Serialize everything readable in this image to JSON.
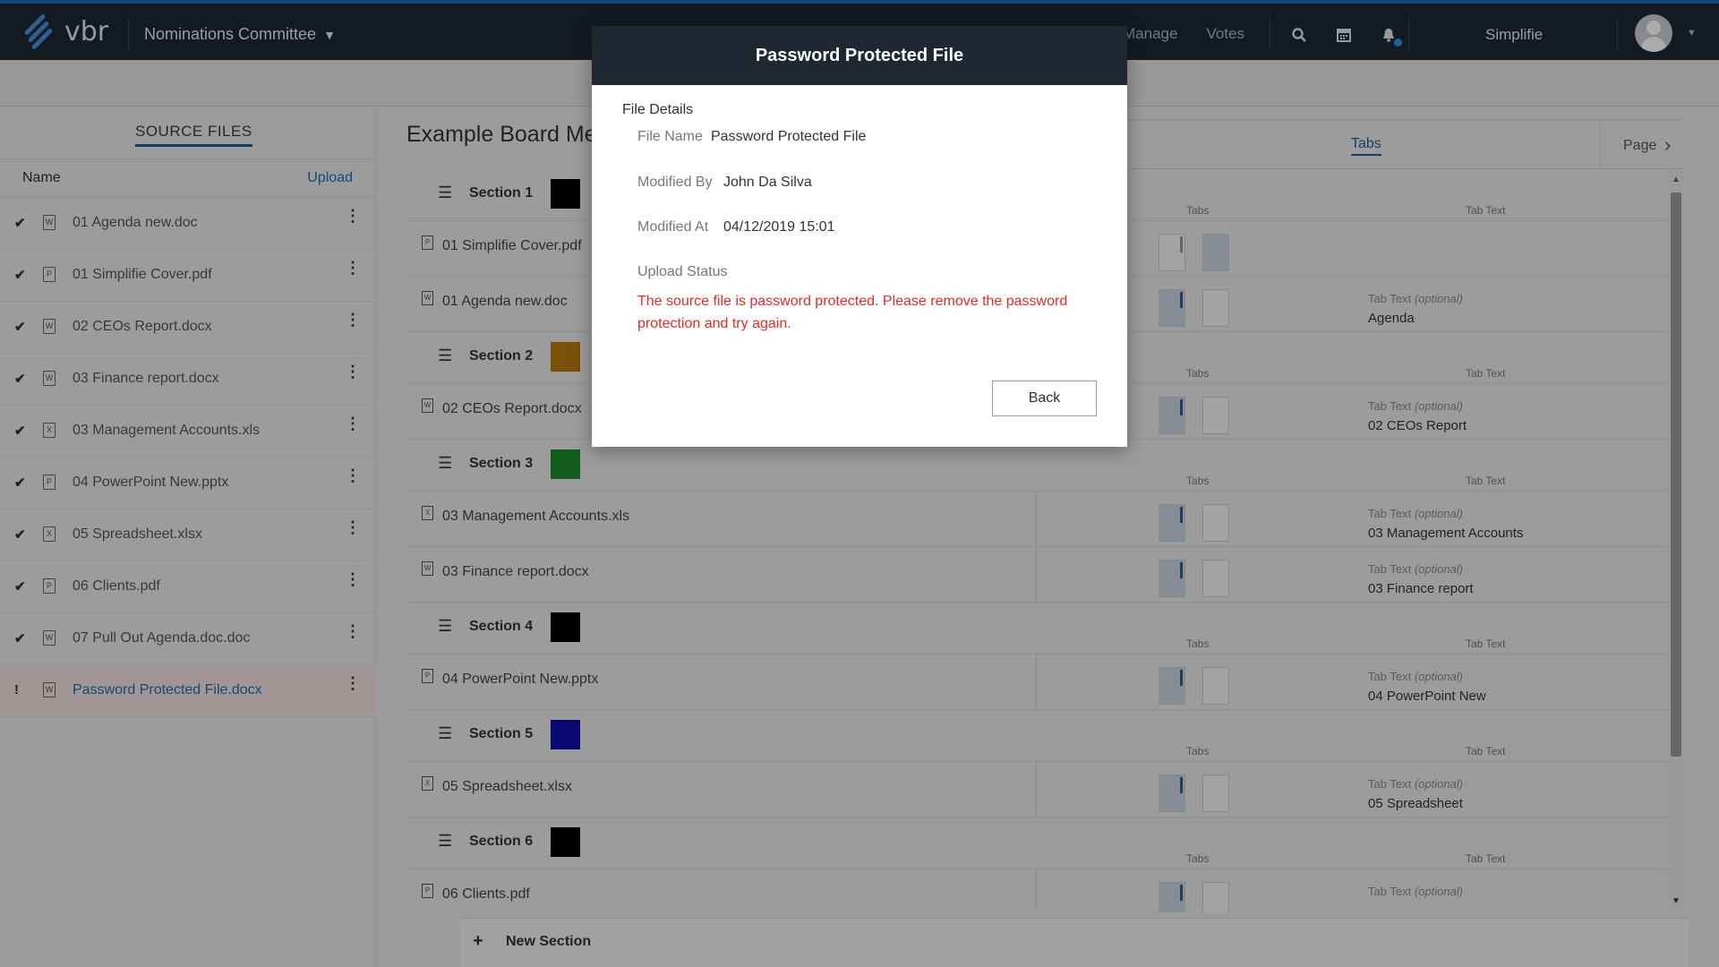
{
  "app": {
    "logo_text": "vbr",
    "committee": "Nominations Committee"
  },
  "nav": {
    "links": [
      "Manage",
      "Votes"
    ],
    "user_name": "Simplifie"
  },
  "left_panel": {
    "title": "SOURCE FILES",
    "name_header": "Name",
    "upload_label": "Upload",
    "files": [
      {
        "status": "✔",
        "icon": "W",
        "name": "01 Agenda new.doc",
        "error": false
      },
      {
        "status": "✔",
        "icon": "P",
        "name": "01 Simplifie Cover.pdf",
        "error": false
      },
      {
        "status": "✔",
        "icon": "W",
        "name": "02 CEOs Report.docx",
        "error": false
      },
      {
        "status": "✔",
        "icon": "W",
        "name": "03 Finance report.docx",
        "error": false
      },
      {
        "status": "✔",
        "icon": "X",
        "name": "03 Management Accounts.xls",
        "error": false
      },
      {
        "status": "✔",
        "icon": "P",
        "name": "04 PowerPoint New.pptx",
        "error": false
      },
      {
        "status": "✔",
        "icon": "X",
        "name": "05 Spreadsheet.xlsx",
        "error": false
      },
      {
        "status": "✔",
        "icon": "P",
        "name": "06 Clients.pdf",
        "error": false
      },
      {
        "status": "✔",
        "icon": "W",
        "name": "07 Pull Out Agenda.doc.doc",
        "error": false
      },
      {
        "status": "!",
        "icon": "W",
        "name": "Password Protected File.docx",
        "error": true
      }
    ]
  },
  "main": {
    "title": "Example Board Meeting",
    "tabs_label": "Tabs",
    "page_label": "Page",
    "col_tabs": "Tabs",
    "col_tab_text": "Tab Text",
    "tab_text_prefix": "Tab Text",
    "tab_text_optional": "(optional)",
    "new_section_label": "New Section",
    "sections": [
      {
        "label": "Section 1",
        "color": "#000000",
        "files": [
          {
            "icon": "P",
            "name": "01 Simplifie Cover.pdf",
            "tab_text": null,
            "cover": true
          },
          {
            "icon": "W",
            "name": "01 Agenda new.doc",
            "tab_text": "Agenda",
            "cover": false
          }
        ]
      },
      {
        "label": "Section 2",
        "color": "#b57a0c",
        "files": [
          {
            "icon": "W",
            "name": "02 CEOs Report.docx",
            "tab_text": "02 CEOs Report",
            "cover": false
          }
        ]
      },
      {
        "label": "Section 3",
        "color": "#1b8a2d",
        "files": [
          {
            "icon": "X",
            "name": "03 Management Accounts.xls",
            "tab_text": "03 Management Accounts",
            "cover": false
          },
          {
            "icon": "W",
            "name": "03 Finance report.docx",
            "tab_text": "03 Finance report",
            "cover": false
          }
        ]
      },
      {
        "label": "Section 4",
        "color": "#000000",
        "files": [
          {
            "icon": "P",
            "name": "04 PowerPoint New.pptx",
            "tab_text": "04 PowerPoint New",
            "cover": false
          }
        ]
      },
      {
        "label": "Section 5",
        "color": "#0c0ca8",
        "files": [
          {
            "icon": "X",
            "name": "05 Spreadsheet.xlsx",
            "tab_text": "05 Spreadsheet",
            "cover": false
          }
        ]
      },
      {
        "label": "Section 6",
        "color": "#000000",
        "files": [
          {
            "icon": "P",
            "name": "06 Clients.pdf",
            "tab_text": "",
            "cover": false
          }
        ]
      }
    ]
  },
  "modal": {
    "title": "Password Protected File",
    "section_label": "File Details",
    "file_name_label": "File Name",
    "file_name": "Password Protected File",
    "modified_by_label": "Modified By",
    "modified_by": "John Da Silva",
    "modified_at_label": "Modified At",
    "modified_at": "04/12/2019 15:01",
    "upload_status_label": "Upload Status",
    "error_message": "The source file is password protected. Please remove the password protection and try again.",
    "back_label": "Back"
  }
}
